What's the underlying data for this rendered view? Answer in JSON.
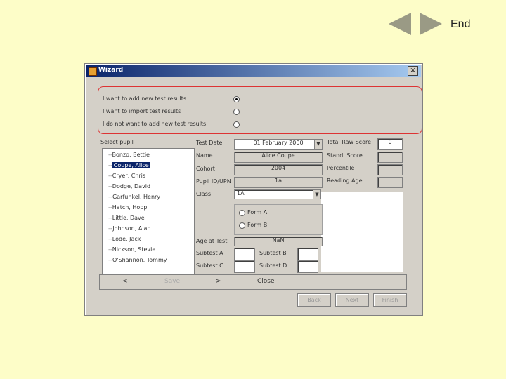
{
  "nav": {
    "end_label": "End"
  },
  "window": {
    "title": "Wizard",
    "close_glyph": "×"
  },
  "options": [
    {
      "label": "I want to add new test results",
      "checked": true
    },
    {
      "label": "I want to import test results",
      "checked": false
    },
    {
      "label": "I do not want to add new test results",
      "checked": false
    }
  ],
  "select_pupil_label": "Select pupil",
  "pupils": [
    "Bonzo, Bettie",
    "Coupe, Alice",
    "Cryer, Chris",
    "Dodge, David",
    "Garfunkel, Henry",
    "Hatch, Hopp",
    "Little, Dave",
    "Johnson, Alan",
    "Lode, Jack",
    "Nickson, Stevie",
    "O'Shannon, Tommy"
  ],
  "selected_pupil_index": 1,
  "fields": {
    "test_date_label": "Test Date",
    "test_date_value": "01 February 2000",
    "name_label": "Name",
    "name_value": "Alice Coupe",
    "cohort_label": "Cohort",
    "cohort_value": "2004",
    "pupil_id_label": "Pupil ID/UPN",
    "pupil_id_value": "1a",
    "class_label": "Class",
    "class_value": "1A",
    "form_a_label": "Form A",
    "form_b_label": "Form B",
    "age_at_test_label": "Age at Test",
    "age_at_test_value": "NaN",
    "subtest_a_label": "Subtest A",
    "subtest_b_label": "Subtest B",
    "subtest_c_label": "Subtest C",
    "subtest_d_label": "Subtest D",
    "total_raw_score_label": "Total Raw Score",
    "total_raw_score_value": "0",
    "stand_score_label": "Stand. Score",
    "percentile_label": "Percentile",
    "reading_age_label": "Reading Age"
  },
  "bottom_bar": {
    "prev": "<",
    "save": "Save",
    "next": ">",
    "close": "Close"
  },
  "buttons": {
    "back": "Back",
    "next": "Next",
    "finish": "Finish"
  }
}
